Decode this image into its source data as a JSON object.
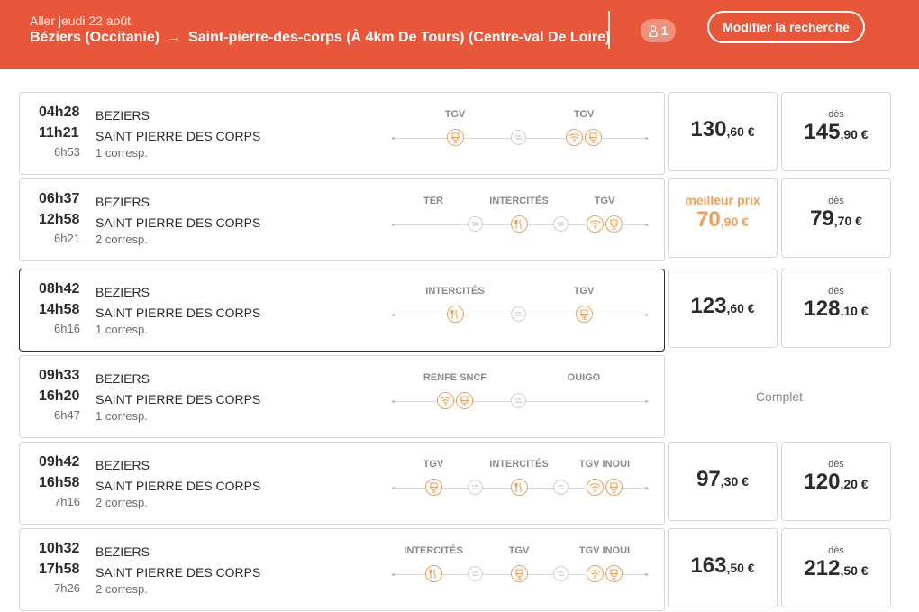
{
  "header": {
    "date": "Aller jeudi 22 août",
    "origin": "Béziers (Occitanie)",
    "destination": "Saint-pierre-des-corps (À 4km De Tours) (Centre-val De Loire)",
    "passengers": "1",
    "modify_label": "Modifier la recherche"
  },
  "colors": {
    "brand": "#e9573a",
    "accent": "#f0a05a"
  },
  "labels": {
    "des": "dès",
    "best": "meilleur prix",
    "complet": "Complet"
  },
  "trips": [
    {
      "dep": "04h28",
      "arr": "11h21",
      "dur": "6h53",
      "from": "BEZIERS",
      "to": "SAINT PIERRE DES CORPS",
      "corresp": "1 corresp.",
      "legs": [
        {
          "label": "TGV",
          "icons": [
            "seat-icon"
          ]
        },
        {
          "label": "TGV",
          "icons": [
            "wifi-icon",
            "seat-icon"
          ]
        }
      ],
      "price1": {
        "int": "130",
        "dec": ",60 €"
      },
      "price2": {
        "int": "145",
        "dec": ",90 €"
      }
    },
    {
      "dep": "06h37",
      "arr": "12h58",
      "dur": "6h21",
      "from": "BEZIERS",
      "to": "SAINT PIERRE DES CORPS",
      "corresp": "2 corresp.",
      "legs": [
        {
          "label": "TER",
          "icons": []
        },
        {
          "label": "INTERCITÉS",
          "icons": [
            "restaurant-icon"
          ]
        },
        {
          "label": "TGV",
          "icons": [
            "wifi-icon",
            "seat-icon"
          ]
        }
      ],
      "price1": {
        "int": "70",
        "dec": ",90 €"
      },
      "price2": {
        "int": "79",
        "dec": ",70 €"
      }
    },
    {
      "dep": "08h42",
      "arr": "14h58",
      "dur": "6h16",
      "from": "BEZIERS",
      "to": "SAINT PIERRE DES CORPS",
      "corresp": "1 corresp.",
      "legs": [
        {
          "label": "INTERCITÉS",
          "icons": [
            "restaurant-icon"
          ]
        },
        {
          "label": "TGV",
          "icons": [
            "seat-icon"
          ]
        }
      ],
      "price1": {
        "int": "123",
        "dec": ",60 €"
      },
      "price2": {
        "int": "128",
        "dec": ",10 €"
      }
    },
    {
      "dep": "09h33",
      "arr": "16h20",
      "dur": "6h47",
      "from": "BEZIERS",
      "to": "SAINT PIERRE DES CORPS",
      "corresp": "1 corresp.",
      "legs": [
        {
          "label": "RENFE SNCF",
          "icons": [
            "wifi-icon",
            "seat-icon"
          ]
        },
        {
          "label": "OUIGO",
          "icons": []
        }
      ]
    },
    {
      "dep": "09h42",
      "arr": "16h58",
      "dur": "7h16",
      "from": "BEZIERS",
      "to": "SAINT PIERRE DES CORPS",
      "corresp": "2 corresp.",
      "legs": [
        {
          "label": "TGV",
          "icons": [
            "seat-icon"
          ]
        },
        {
          "label": "INTERCITÉS",
          "icons": [
            "restaurant-icon"
          ]
        },
        {
          "label": "TGV INOUI",
          "icons": [
            "wifi-icon",
            "seat-icon"
          ]
        }
      ],
      "price1": {
        "int": "97",
        "dec": ",30 €"
      },
      "price2": {
        "int": "120",
        "dec": ",20 €"
      }
    },
    {
      "dep": "10h32",
      "arr": "17h58",
      "dur": "7h26",
      "from": "BEZIERS",
      "to": "SAINT PIERRE DES CORPS",
      "corresp": "2 corresp.",
      "legs": [
        {
          "label": "INTERCITÉS",
          "icons": [
            "restaurant-icon"
          ]
        },
        {
          "label": "TGV",
          "icons": [
            "seat-icon"
          ]
        },
        {
          "label": "TGV INOUI",
          "icons": [
            "wifi-icon",
            "seat-icon"
          ]
        }
      ],
      "price1": {
        "int": "163",
        "dec": ",50 €"
      },
      "price2": {
        "int": "212",
        "dec": ",50 €"
      }
    }
  ]
}
